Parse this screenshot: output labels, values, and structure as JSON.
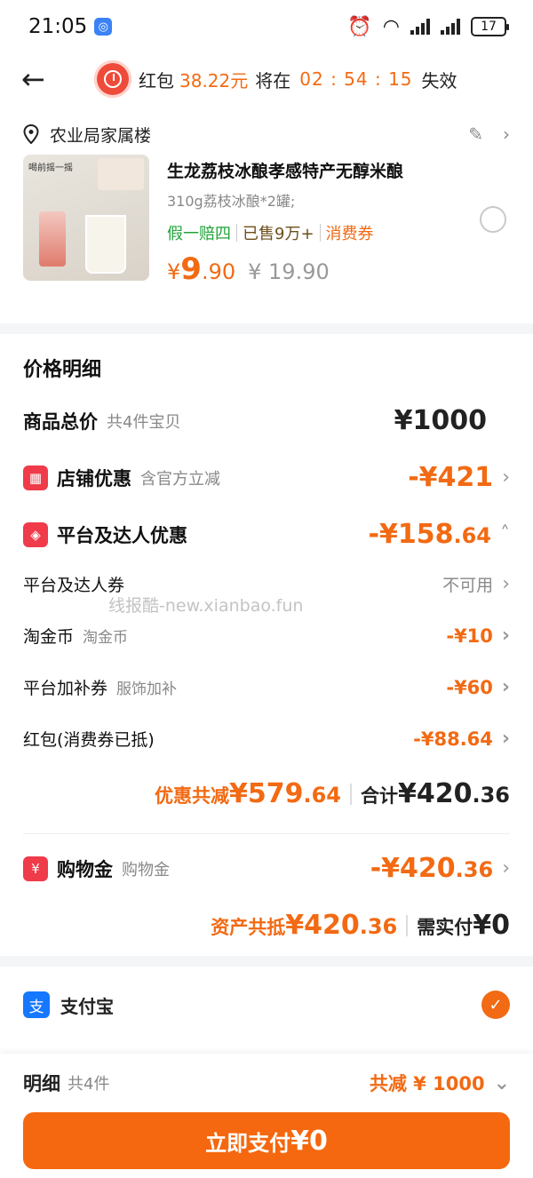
{
  "status_bar": {
    "time": "21:05",
    "battery": "17"
  },
  "header": {
    "redpacket_label": "红包",
    "redpacket_amount": "38.22元",
    "will_at": "将在",
    "timer": "02 : 54 : 15",
    "expire": "失效"
  },
  "address": {
    "text": "农业局家属楼"
  },
  "product": {
    "title": "生龙荔枝冰酿孝感特产无醇米酿",
    "spec": "310g荔枝冰酿*2罐;",
    "tags": [
      "假一赔四",
      "已售9万+",
      "消费券"
    ],
    "price_symbol": "¥",
    "price_int": "9",
    "price_dec": ".90",
    "price_old": "¥ 19.90",
    "image_caption": "喝前摇一摇"
  },
  "detail": {
    "title": "价格明细",
    "goods_total_label": "商品总价",
    "goods_total_sub": "共4件宝贝",
    "goods_total_val": "¥1000",
    "shop_label": "店铺优惠",
    "shop_sub": "含官方立减",
    "shop_val": "-¥421",
    "platform_label": "平台及达人优惠",
    "platform_val_int": "-¥158",
    "platform_val_dec": ".64",
    "coupon_label": "平台及达人券",
    "coupon_val": "不可用",
    "gold_label": "淘金币",
    "gold_sub": "淘金币",
    "gold_val": "-¥10",
    "addon_label": "平台加补券",
    "addon_sub": "服饰加补",
    "addon_val": "-¥60",
    "hongbao_label": "红包(消费券已抵)",
    "hongbao_val": "-¥88.64",
    "discount_lbl": "优惠共减",
    "discount_int": "¥579",
    "discount_dec": ".64",
    "sum_lbl": "合计",
    "sum_int": "¥420",
    "sum_dec": ".36",
    "shopping_label": "购物金",
    "shopping_sub": "购物金",
    "shopping_val_int": "-¥420",
    "shopping_val_dec": ".36",
    "asset_lbl": "资产共抵",
    "asset_int": "¥420",
    "asset_dec": ".36",
    "need_lbl": "需实付",
    "need_val": "¥0",
    "watermark": "线报酷-new.xianbao.fun"
  },
  "payment": {
    "method": "支付宝"
  },
  "bottom": {
    "detail_lbl": "明细",
    "count": "共4件",
    "total": "共减 ¥ 1000",
    "pay_label": "立即支付",
    "pay_amount": "¥0"
  },
  "colors": {
    "accent": "#f26a13",
    "green": "#21a33a",
    "red": "#ef3b4a",
    "alipay": "#1677ff"
  }
}
